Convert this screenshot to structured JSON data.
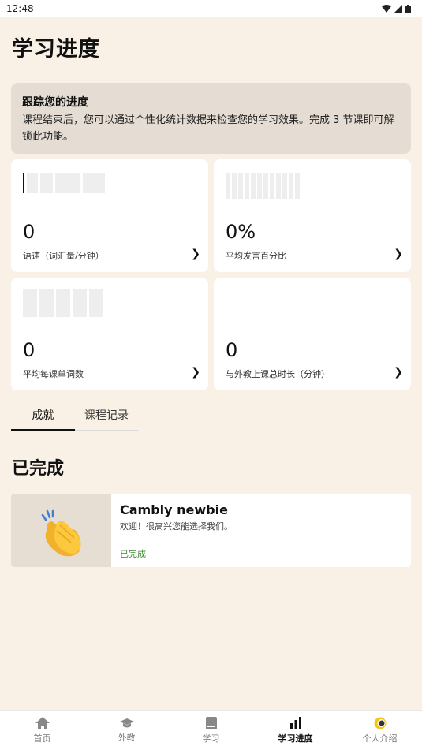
{
  "status": {
    "time": "12:48"
  },
  "page": {
    "title": "学习进度"
  },
  "banner": {
    "title": "跟踪您的进度",
    "body": "课程结束后，您可以通过个性化统计数据来检查您的学习效果。完成 3 节课即可解锁此功能。"
  },
  "stats": [
    {
      "value": "0",
      "label": "语速（词汇量/分钟）"
    },
    {
      "value": "0%",
      "label": "平均发言百分比"
    },
    {
      "value": "0",
      "label": "平均每课单词数"
    },
    {
      "value": "0",
      "label": "与外教上课总时长（分钟）"
    }
  ],
  "tabs": [
    {
      "label": "成就",
      "active": true
    },
    {
      "label": "课程记录",
      "active": false
    }
  ],
  "section": {
    "completed_title": "已完成"
  },
  "achievement": {
    "title": "Cambly newbie",
    "description": "欢迎！很高兴您能选择我们。",
    "status": "已完成"
  },
  "nav": [
    {
      "label": "首页",
      "icon": "home-icon"
    },
    {
      "label": "外教",
      "icon": "graduation-cap-icon"
    },
    {
      "label": "学习",
      "icon": "book-icon"
    },
    {
      "label": "学习进度",
      "icon": "bar-chart-icon",
      "active": true
    },
    {
      "label": "个人介绍",
      "icon": "profile-icon"
    }
  ],
  "colors": {
    "background": "#faf1e6",
    "banner": "#e5ddd3",
    "completed_green": "#3a8a2f"
  }
}
